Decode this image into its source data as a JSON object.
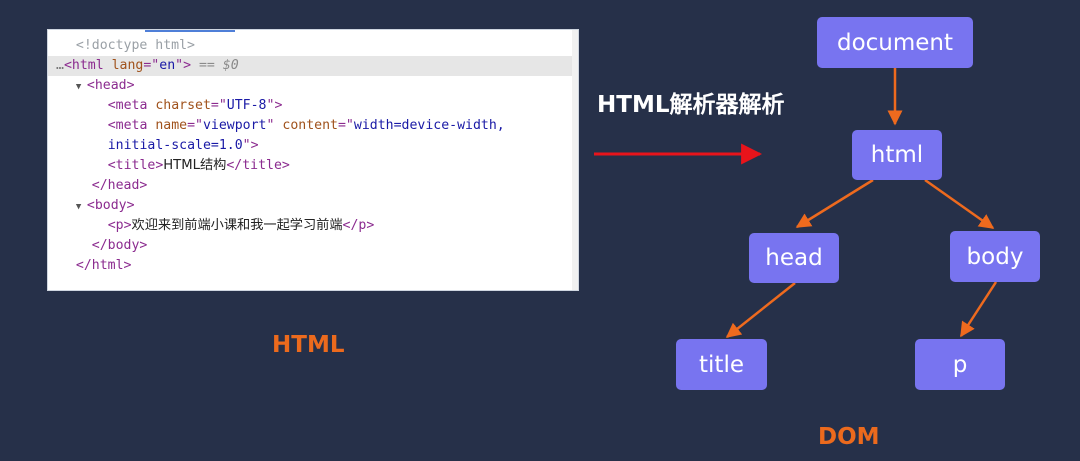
{
  "code_panel": {
    "lines": [
      {
        "indent": 2,
        "tokens": [
          {
            "c": "cm",
            "t": "<!doctype html>"
          }
        ]
      },
      {
        "indent": 0,
        "selected": true,
        "tokens": [
          {
            "c": "dots",
            "t": "…"
          },
          {
            "c": "tg",
            "t": "<html "
          },
          {
            "c": "an",
            "t": "lang"
          },
          {
            "c": "tg",
            "t": "=\""
          },
          {
            "c": "av",
            "t": "en"
          },
          {
            "c": "tg",
            "t": "\">"
          },
          {
            "c": "dim",
            "t": " == $0"
          }
        ]
      },
      {
        "indent": 2,
        "tokens": [
          {
            "c": "tri",
            "t": "▼"
          },
          {
            "c": "tg",
            "t": "<head>"
          }
        ]
      },
      {
        "indent": 6,
        "tokens": [
          {
            "c": "tg",
            "t": "<meta "
          },
          {
            "c": "an",
            "t": "charset"
          },
          {
            "c": "tg",
            "t": "=\""
          },
          {
            "c": "av",
            "t": "UTF-8"
          },
          {
            "c": "tg",
            "t": "\">"
          }
        ]
      },
      {
        "indent": 6,
        "tokens": [
          {
            "c": "tg",
            "t": "<meta "
          },
          {
            "c": "an",
            "t": "name"
          },
          {
            "c": "tg",
            "t": "=\""
          },
          {
            "c": "av",
            "t": "viewport"
          },
          {
            "c": "tg",
            "t": "\" "
          },
          {
            "c": "an",
            "t": "content"
          },
          {
            "c": "tg",
            "t": "=\""
          },
          {
            "c": "av",
            "t": "width=device-width,"
          }
        ]
      },
      {
        "indent": 6,
        "tokens": [
          {
            "c": "av",
            "t": "initial-scale=1.0"
          },
          {
            "c": "tg",
            "t": "\">"
          }
        ]
      },
      {
        "indent": 6,
        "tokens": [
          {
            "c": "tg",
            "t": "<title>"
          },
          {
            "c": "tx",
            "t": "HTML结构"
          },
          {
            "c": "tg",
            "t": "</title>"
          }
        ]
      },
      {
        "indent": 4,
        "tokens": [
          {
            "c": "tg",
            "t": "</head>"
          }
        ]
      },
      {
        "indent": 2,
        "tokens": [
          {
            "c": "tri",
            "t": "▼"
          },
          {
            "c": "tg",
            "t": "<body>"
          }
        ]
      },
      {
        "indent": 6,
        "tokens": [
          {
            "c": "tg",
            "t": "<p>"
          },
          {
            "c": "tx",
            "t": "欢迎来到前端小课和我一起学习前端"
          },
          {
            "c": "tg",
            "t": "</p>"
          }
        ]
      },
      {
        "indent": 4,
        "tokens": [
          {
            "c": "tg",
            "t": "</body>"
          }
        ]
      },
      {
        "indent": 2,
        "tokens": [
          {
            "c": "tg",
            "t": "</html>"
          }
        ]
      }
    ]
  },
  "labels": {
    "html_caption": "HTML",
    "dom_caption": "DOM",
    "parser": "HTML解析器解析"
  },
  "tree": {
    "document": "document",
    "html": "html",
    "head": "head",
    "body": "body",
    "title": "title",
    "p": "p"
  },
  "colors": {
    "background": "#263049",
    "node": "#7874f0",
    "edge": "#ee6a1e",
    "arrow": "#e8141b",
    "caption": "#ec6a1d"
  }
}
